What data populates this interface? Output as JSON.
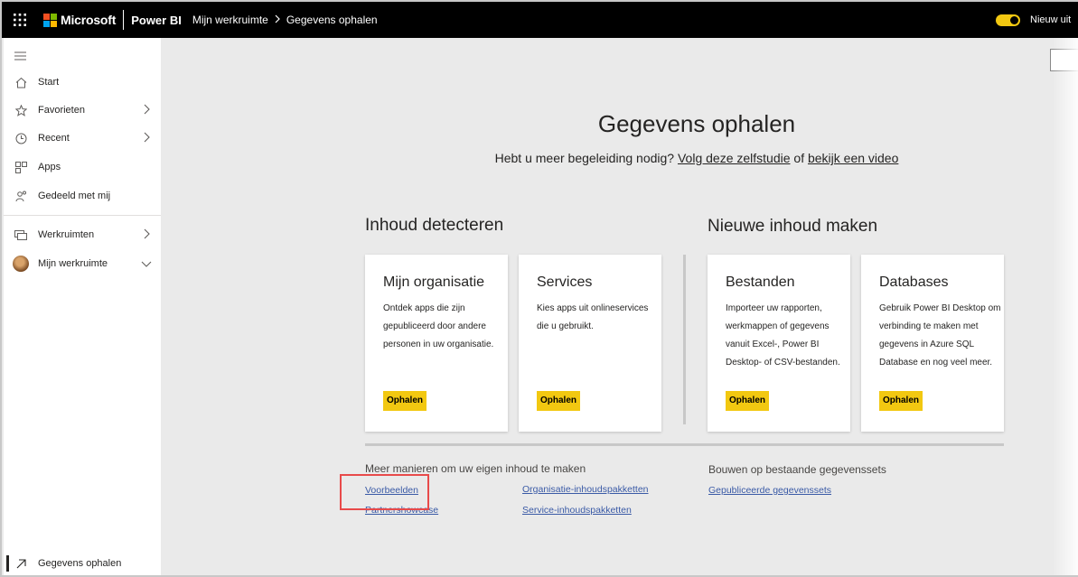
{
  "topbar": {
    "brand": "Microsoft",
    "product": "Power BI",
    "breadcrumb": [
      "Mijn werkruimte",
      "Gegevens ophalen"
    ],
    "toggle_label": "Nieuw uit",
    "toggle_on": true
  },
  "sidebar": {
    "items": [
      {
        "label": "Start",
        "icon": "home-icon"
      },
      {
        "label": "Favorieten",
        "icon": "star-icon"
      },
      {
        "label": "Recent",
        "icon": "clock-icon"
      },
      {
        "label": "Apps",
        "icon": "apps-icon"
      },
      {
        "label": "Gedeeld met mij",
        "icon": "shared-icon"
      },
      {
        "label": "Werkruimten",
        "icon": "workspaces-icon"
      },
      {
        "label": "Mijn werkruimte",
        "icon": "avatar"
      }
    ],
    "bottom_item": {
      "label": "Gegevens ophalen",
      "icon": "arrow-up-right-icon"
    }
  },
  "main": {
    "title": "Gegevens ophalen",
    "subtitle_prefix": "Hebt u meer begeleiding nodig?",
    "subtitle_link1": "Volg deze zelfstudie",
    "subtitle_mid": "of",
    "subtitle_link2": "bekijk een video",
    "discover_title": "Inhoud detecteren",
    "create_title": "Nieuwe inhoud maken",
    "cards": [
      {
        "title": "Mijn organisatie",
        "desc": "Ontdek apps die zijn gepubliceerd door andere personen in uw organisatie.",
        "button": "Ophalen"
      },
      {
        "title": "Services",
        "desc": "Kies apps uit onlineservices die u gebruikt.",
        "button": "Ophalen"
      },
      {
        "title": "Bestanden",
        "desc": "Importeer uw rapporten, werkmappen of gegevens vanuit Excel-, Power BI Desktop- of CSV-bestanden.",
        "button": "Ophalen"
      },
      {
        "title": "Databases",
        "desc": "Gebruik Power BI Desktop om verbinding te maken met gegevens in Azure SQL Database en nog veel meer.",
        "button": "Ophalen"
      }
    ],
    "more_title": "Meer manieren om uw eigen inhoud te maken",
    "more_links": [
      "Voorbeelden",
      "Partnershowcase",
      "Organisatie-inhoudspakketten",
      "Service-inhoudspakketten"
    ],
    "build_title": "Bouwen op bestaande gegevenssets",
    "build_links": [
      "Gepubliceerde gegevenssets"
    ]
  },
  "colors": {
    "accent": "#f2c811",
    "link": "#3a5aa6",
    "highlight": "#e84a4a"
  }
}
